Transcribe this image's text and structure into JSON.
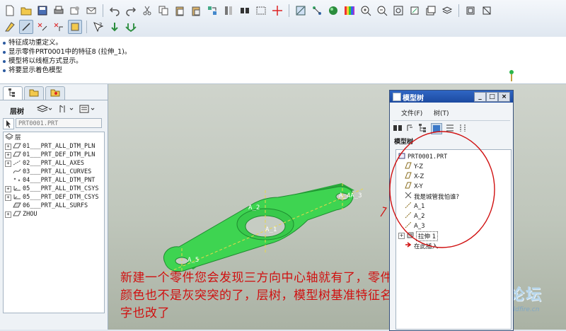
{
  "toolbar": {
    "row1_icons": [
      "new-icon",
      "open-icon",
      "save-icon",
      "print-icon",
      "copy-window-icon",
      "email-icon",
      "undo-icon",
      "redo-icon",
      "cut-icon",
      "copy-icon",
      "paste-icon",
      "paste-special-icon",
      "regenerate-icon",
      "find-icon",
      "select-box-icon",
      "crosshair-icon",
      "datum-display-icon",
      "axis-icon",
      "shading-icon",
      "color-icon",
      "zoom-in-icon",
      "zoom-out-icon",
      "refit-icon",
      "orient-icon",
      "saved-views-icon",
      "layers-icon",
      "view-manager-icon"
    ],
    "row2_icons": [
      "sketch-edit-icon",
      "sketch-line-icon",
      "sketch-modify-icon",
      "sketch-trim-icon",
      "sketch-select-icon",
      "help-whats-this-icon",
      "green-arrow-icon",
      "green-double-arrow-icon"
    ]
  },
  "messages": [
    "特征成功重定义。",
    "显示零件PRT0001中的特征8 (拉伸_1)。",
    "模型将以线框方式显示。",
    "将要显示着色模型"
  ],
  "left_panel": {
    "tab_icons": [
      "model-tree-tab-icon",
      "folder-tab-icon",
      "favorites-tab-icon"
    ],
    "layer_tree_label": "层树",
    "search_value": "PRT0001.PRT",
    "tree_root": "层",
    "layers": [
      "01___PRT_ALL_DTM_PLN",
      "01___PRT_DEF_DTM_PLN",
      "02___PRT_ALL_AXES",
      "03___PRT_ALL_CURVES",
      "04___PRT_ALL_DTM_PNT",
      "05___PRT_ALL_DTM_CSYS",
      "05___PRT_DEF_DTM_CSYS",
      "06___PRT_ALL_SURFS",
      "ZHOU"
    ]
  },
  "viewport": {
    "axis_labels": [
      "A_2",
      "A_1",
      "A_4A_3",
      "A_5"
    ],
    "annotation_lines": [
      "新建一个零件您会发现三方向中心轴就有了，零件",
      "颜色也不是灰突突的了，层树，模型树基准特征名",
      "字也改了"
    ],
    "watermark": "野火论坛",
    "watermark_url": "www.proewildfire.cn"
  },
  "model_tree_window": {
    "title": "模型树",
    "menu": [
      "文件(F)",
      "树(T)"
    ],
    "header": "模型树",
    "items": [
      "PRT0001.PRT",
      "Y-Z",
      "X-Z",
      "X-Y",
      "我是城管我怕谁?",
      "A_1",
      "A_2",
      "A_3",
      "拉伸 1",
      "在此插入"
    ]
  },
  "colors": {
    "part": "#3ed451",
    "annotation": "#d01010",
    "titlebar": "#2458b8"
  }
}
